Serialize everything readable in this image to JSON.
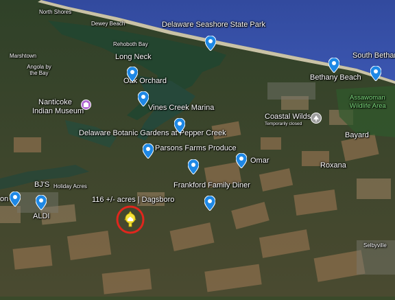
{
  "map": {
    "colors": {
      "ocean": "#3a4fa8",
      "bay": "#24452e",
      "land": "#3f5131",
      "field": "#8a6a4a",
      "pin": "#1e88e5",
      "subject_ring": "#e0261d",
      "subject_marker": "#f5e23a"
    },
    "places": {
      "north_shores": "North Shores",
      "dewey_beach": "Dewey Beach",
      "delaware_seashore": "Delaware Seashore State Park",
      "rehoboth_bay": "Rehoboth Bay",
      "long_neck": "Long Neck",
      "marshtown": "Marshtown",
      "angola": "Angola by\nthe Bay",
      "oak_orchard": "Oak Orchard",
      "nanticoke_line1": "Nanticoke",
      "nanticoke_line2": "Indian Museum",
      "vines_creek": "Vines Creek Marina",
      "botanic": "Delaware Botanic Gardens at Pepper Creek",
      "parsons": "Parsons Farms Produce",
      "omar": "Omar",
      "frankford": "Frankford Family Diner",
      "bjs": "BJ'S",
      "holiday_acres": "Holiday Acres",
      "subject_label": "116 +/- acres | Dagsboro",
      "on": "on",
      "aldi": "ALDI",
      "coastal_wilds": "Coastal Wilds",
      "temporarily_closed": "Temporarily closed",
      "bethany_beach": "Bethany Beach",
      "south_bethany": "South Bethan",
      "assawoman_line1": "Assawoman",
      "assawoman_line2": "Wildlife Area",
      "bayard": "Bayard",
      "roxana": "Roxana",
      "selbyville": "Selbyville"
    }
  }
}
